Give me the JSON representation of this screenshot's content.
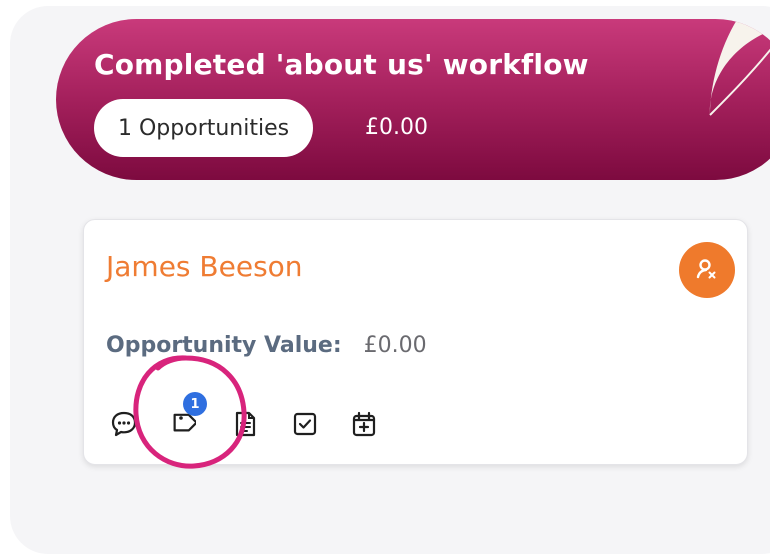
{
  "stage": {
    "title": "Completed 'about us' workflow",
    "opportunities_label": "1 Opportunities",
    "total_value": "£0.00",
    "gradient_top": "#c93a7b",
    "gradient_bottom": "#7d0a3f"
  },
  "card": {
    "contact_name": "James Beeson",
    "name_color": "#ef7c33",
    "assign_icon": "user-unassigned-icon",
    "value_label": "Opportunity Value:",
    "value_amount": "£0.00",
    "actions": [
      {
        "icon": "chat-icon"
      },
      {
        "icon": "tag-icon",
        "badge": "1"
      },
      {
        "icon": "notes-icon"
      },
      {
        "icon": "task-checkbox-icon"
      },
      {
        "icon": "calendar-add-icon"
      }
    ]
  },
  "annotation": {
    "ring_color": "#d8247c"
  }
}
